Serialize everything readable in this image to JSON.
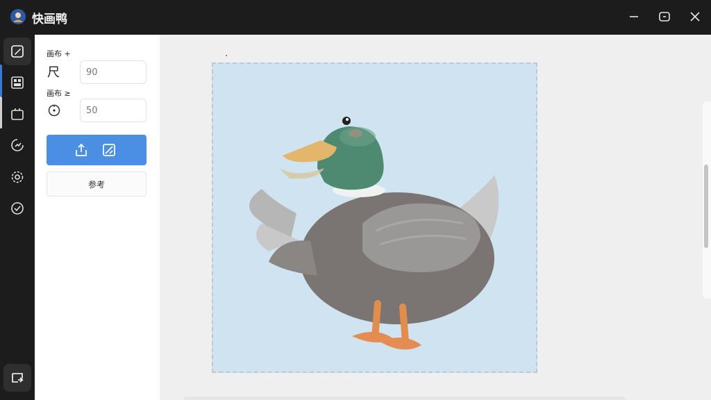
{
  "app": {
    "title": "快画鸭",
    "logo_icon": "avatar-logo-icon"
  },
  "window_controls": [
    "minimize-icon",
    "maximize-icon",
    "close-icon"
  ],
  "rail": {
    "items": [
      {
        "icon": "edit-pen-icon",
        "active": true
      },
      {
        "icon": "layout-icon",
        "active": false
      },
      {
        "icon": "crop-frame-icon",
        "active": false
      },
      {
        "icon": "chart-refresh-icon",
        "active": false
      },
      {
        "icon": "gear-icon",
        "active": false
      },
      {
        "icon": "check-circle-icon",
        "active": false
      }
    ],
    "bottom_icon": "share-exit-icon"
  },
  "panel": {
    "label_size": "画布 +",
    "size_icon": "ruler-icon",
    "size_value": "90",
    "label_other": "画布 ≥",
    "other_icon": "timer-icon",
    "other_value": "50",
    "action_icons": [
      "upload-icon",
      "image-edit-icon"
    ],
    "reference_label": "参考"
  },
  "colors": {
    "accent": "#4a8fe4",
    "rail_indicator": "#3a7bd5",
    "canvas_bg": "#cfe3f1"
  },
  "canvas": {
    "subject": "duck-illustration"
  }
}
